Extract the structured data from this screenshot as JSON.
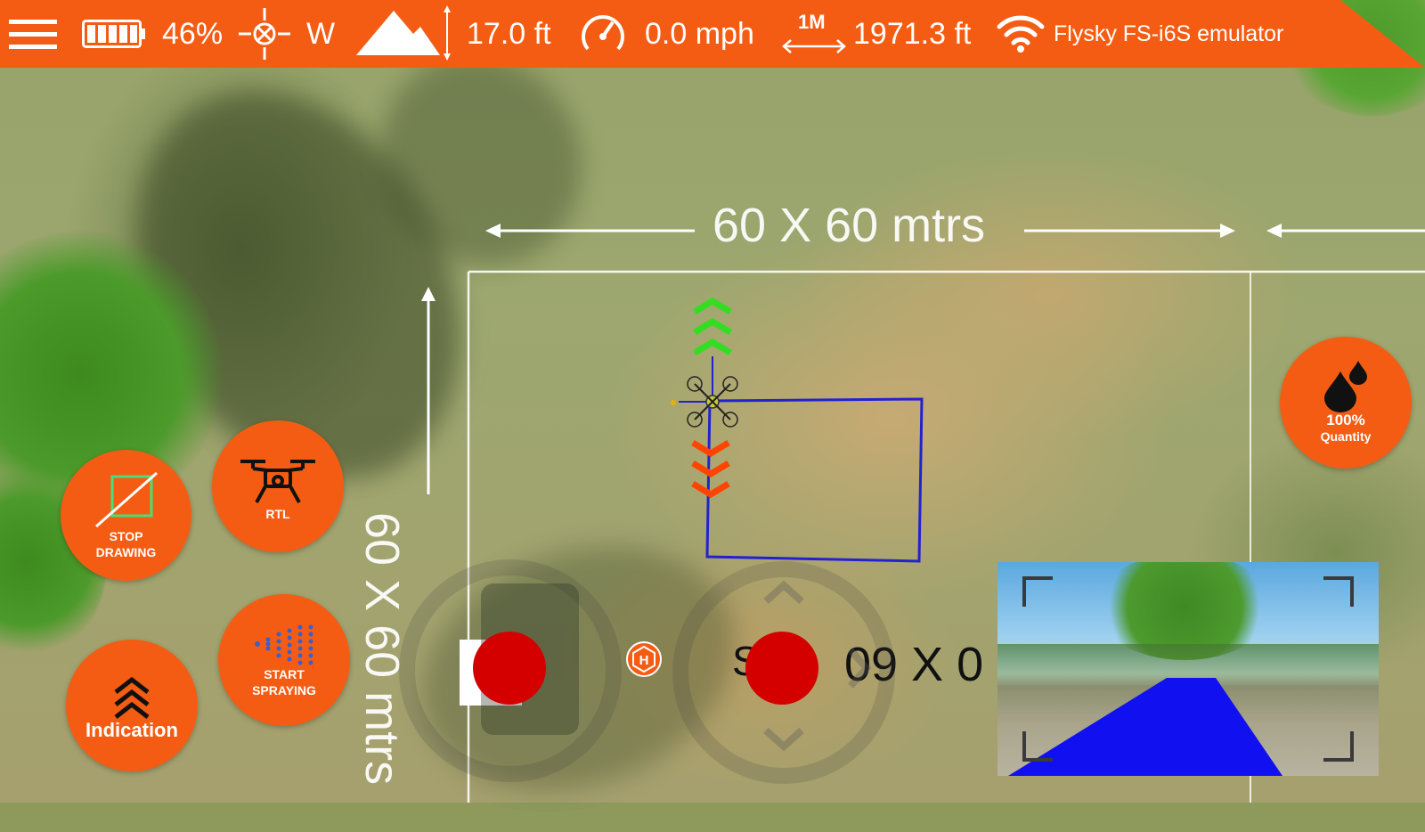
{
  "top_bar": {
    "battery_percent": "46%",
    "heading": "W",
    "altitude": "17.0 ft",
    "speed": "0.0 mph",
    "scale_label": "1M",
    "distance": "1971.3 ft",
    "controller": "Flysky FS-i6S emulator",
    "color": "#f55c13"
  },
  "map": {
    "horizontal_measure": "60 X 60 mtrs",
    "vertical_measure": "60 X 60 mtrs",
    "overlay_text": "09 X 0",
    "overlay_text_partial": "S"
  },
  "buttons": {
    "stop_drawing_line1": "STOP",
    "stop_drawing_line2": "DRAWING",
    "rtl": "RTL",
    "indication": "Indication",
    "start_spraying_line1": "START",
    "start_spraying_line2": "SPRAYING",
    "quantity_percent": "100%",
    "quantity_label": "Quantity"
  },
  "colors": {
    "path": "#2222d0",
    "stick_knob": "#d40000",
    "up_chevrons": "#33dd22",
    "down_chevrons": "#ff4400"
  }
}
